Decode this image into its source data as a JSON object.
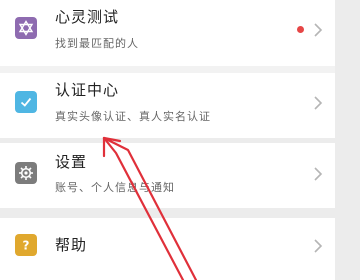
{
  "colors": {
    "page_background": "#ececec",
    "card_background": "#ffffff",
    "notification_dot": "#e64646",
    "annotation_arrow": "#e0303a",
    "chevron": "#b5b5b5"
  },
  "menu": {
    "items": [
      {
        "title": "心灵测试",
        "subtitle": "找到最匹配的人",
        "icon": "star-of-david-icon",
        "icon_color": "#8e6bb0",
        "has_notification_dot": true
      },
      {
        "title": "认证中心",
        "subtitle": "真实头像认证、真人实名认证",
        "icon": "checkbox-icon",
        "icon_color": "#4fb6e3",
        "has_notification_dot": false
      },
      {
        "title": "设置",
        "subtitle": "账号、个人信息与通知",
        "icon": "gear-icon",
        "icon_color": "#7c7c7c",
        "has_notification_dot": false
      },
      {
        "title": "帮助",
        "subtitle": "",
        "icon": "question-icon",
        "icon_color": "#e0a82e",
        "has_notification_dot": false
      }
    ]
  }
}
